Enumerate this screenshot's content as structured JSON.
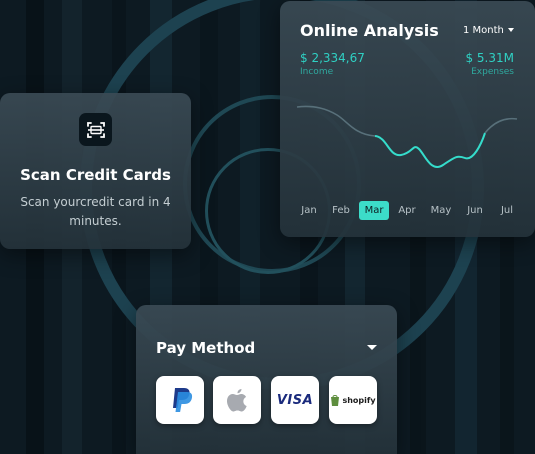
{
  "scan_card": {
    "title": "Scan Credit Cards",
    "description": "Scan yourcredit card in 4 minutes.",
    "icon": "scan-card-icon"
  },
  "analysis": {
    "title": "Online Analysis",
    "period": "1 Month",
    "income_value": "$ 2,334,67",
    "income_label": "Income",
    "expenses_value": "$ 5.31M",
    "expenses_label": "Expenses",
    "months": [
      "Jan",
      "Feb",
      "Mar",
      "Apr",
      "May",
      "Jun",
      "Jul"
    ],
    "active_month": "Mar",
    "accent_color": "#3cdcc9"
  },
  "pay_method": {
    "title": "Pay Method",
    "options": [
      {
        "name": "PayPal",
        "icon": "paypal-icon"
      },
      {
        "name": "Apple",
        "icon": "apple-icon"
      },
      {
        "name": "VISA",
        "icon": "visa-icon"
      },
      {
        "name": "shopify",
        "icon": "shopify-icon"
      }
    ]
  }
}
